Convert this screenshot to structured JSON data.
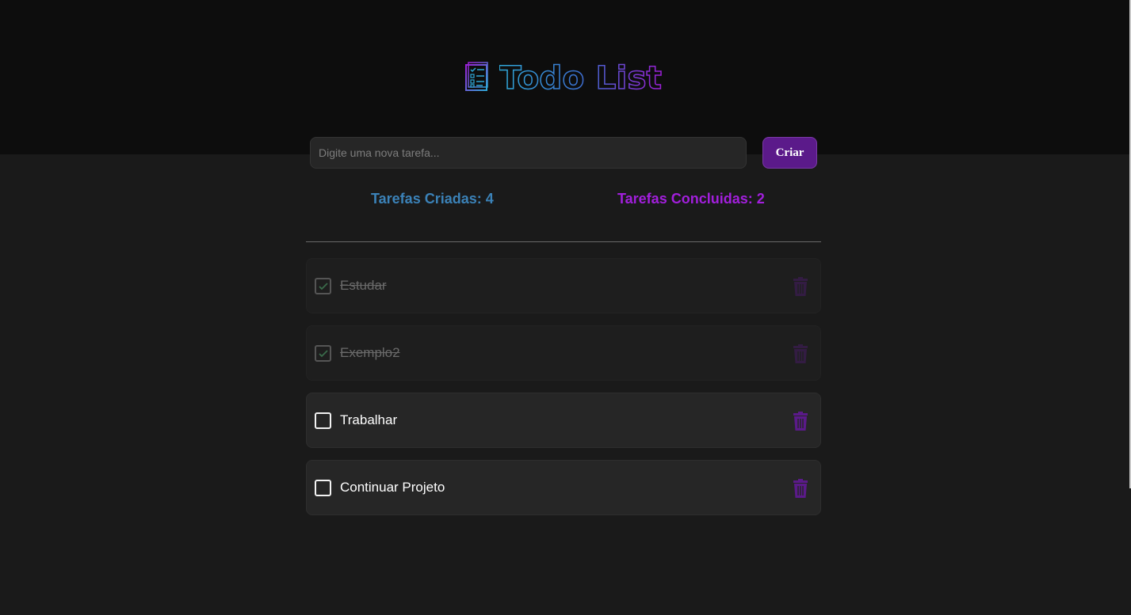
{
  "app": {
    "title": "Todo List"
  },
  "form": {
    "placeholder": "Digite uma nova tarefa...",
    "create_label": "Criar"
  },
  "counters": {
    "created_label": "Tarefas Criadas: 4",
    "done_label": "Tarefas Concluidas: 2"
  },
  "tasks": [
    {
      "text": "Estudar",
      "completed": true
    },
    {
      "text": "Exemplo2",
      "completed": true
    },
    {
      "text": "Trabalhar",
      "completed": false
    },
    {
      "text": "Continuar Projeto",
      "completed": false
    }
  ],
  "colors": {
    "accent_purple": "#5b1a8a",
    "created_blue": "#3b82b8",
    "done_purple": "#a21fdc",
    "trash_purple": "#5b1a8a"
  },
  "icons": {
    "logo": "checklist-icon",
    "checkbox_checked": "check-icon",
    "delete": "trash-icon"
  }
}
